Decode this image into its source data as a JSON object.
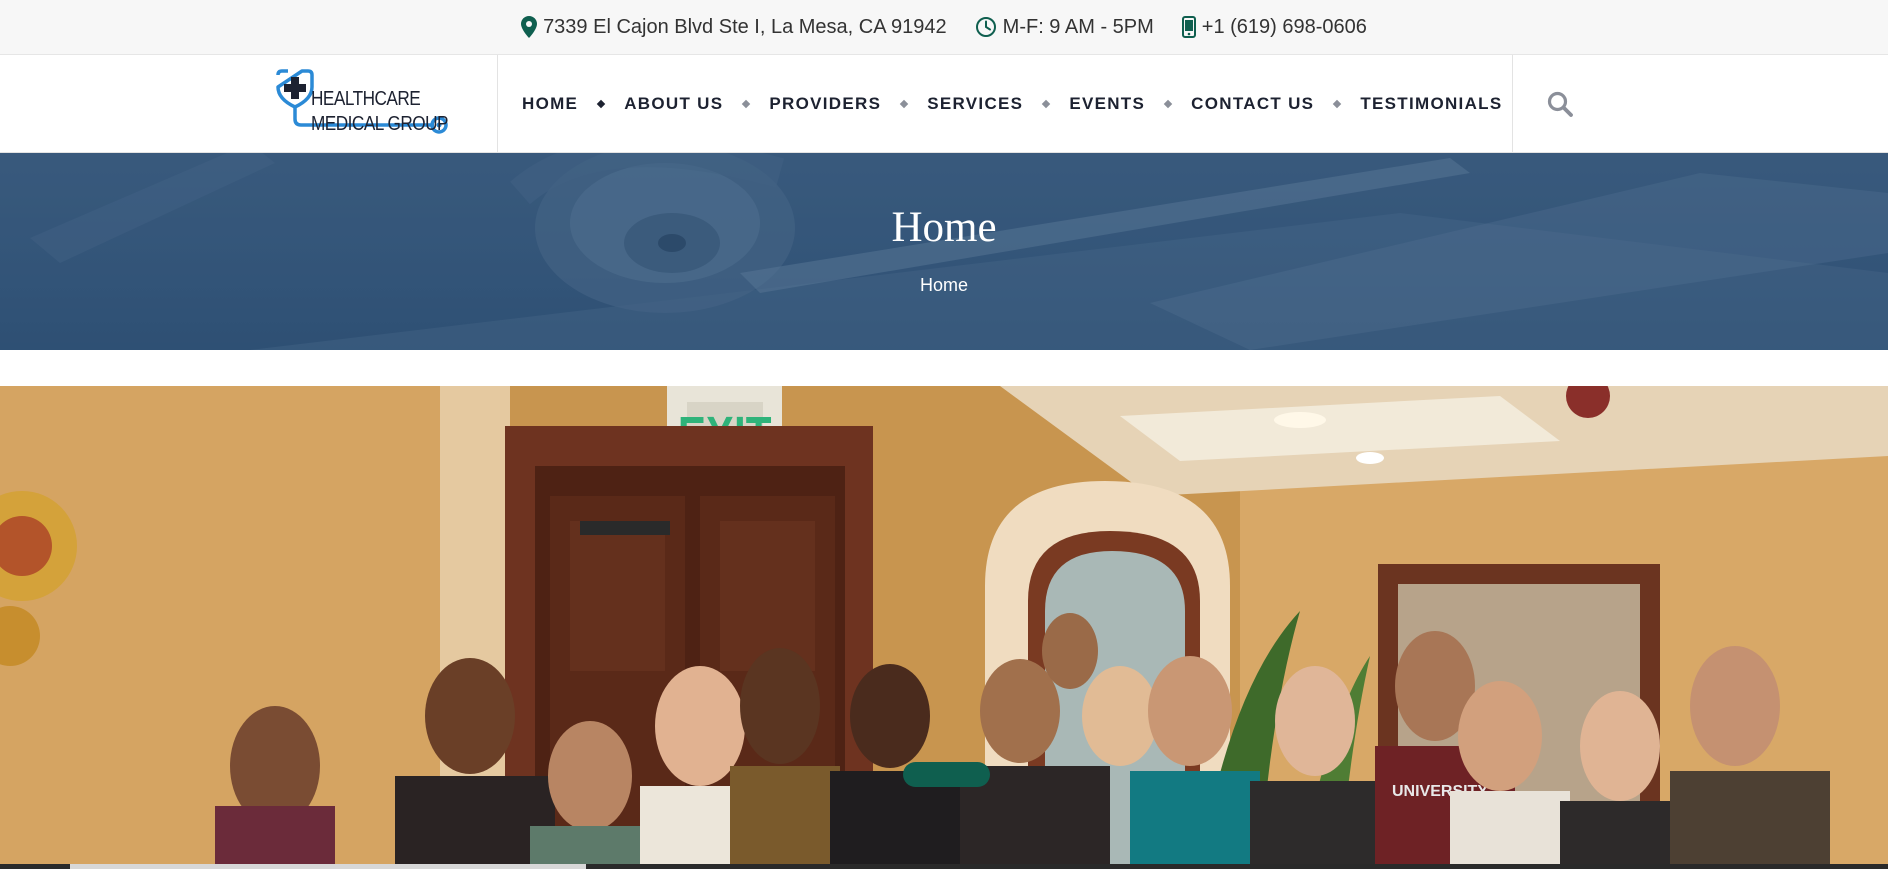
{
  "topbar": {
    "address": "7339 El Cajon Blvd Ste I, La Mesa, CA 91942",
    "hours": "M-F: 9 AM - 5PM",
    "phone": "+1 (619) 698-0606",
    "icon_color": "#0f5f4f"
  },
  "logo": {
    "line1": "HEALTHCARE",
    "line2": "MEDICAL GROUP",
    "icon": "stethoscope-cross-icon",
    "color": "#2b8ad6"
  },
  "nav": {
    "items": [
      "HOME",
      "ABOUT US",
      "PROVIDERS",
      "SERVICES",
      "EVENTS",
      "CONTACT US",
      "TESTIMONIALS"
    ],
    "search_icon": "search-icon"
  },
  "banner": {
    "title": "Home",
    "breadcrumb": "Home"
  },
  "photo": {
    "exit_sign": "EXIT",
    "shirt_text": "UNIVERSITY"
  },
  "colors": {
    "accent": "#0f5f4f",
    "banner": "#36577c",
    "text": "#1d2231"
  }
}
